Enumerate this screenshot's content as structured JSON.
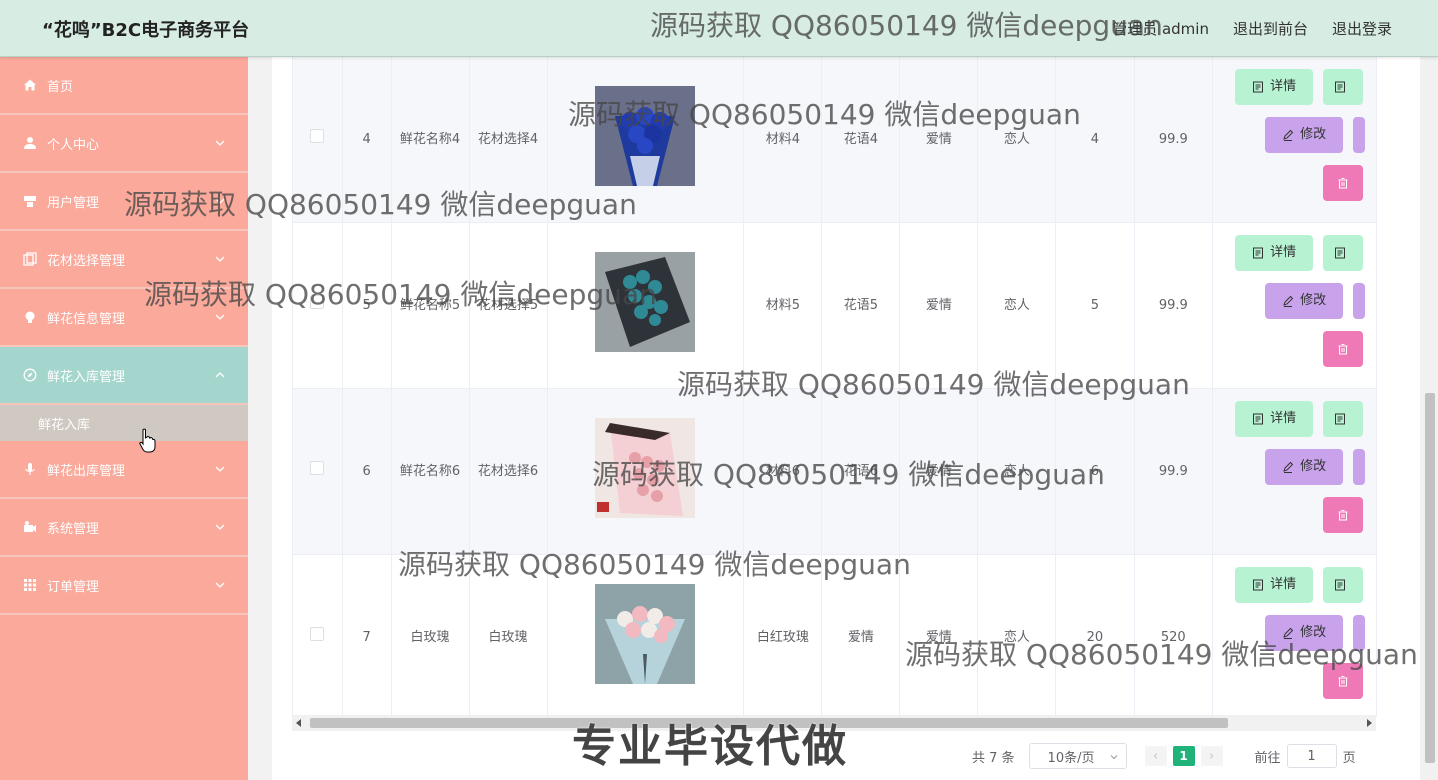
{
  "header": {
    "brand": "“花鸣”B2C电子商务平台",
    "user": "管理员 admin",
    "to_front": "退出到前台",
    "logout": "退出登录"
  },
  "sidebar": {
    "items": [
      {
        "label": "首页",
        "icon": "home-icon"
      },
      {
        "label": "个人中心",
        "icon": "user-icon"
      },
      {
        "label": "用户管理",
        "icon": "users-icon"
      },
      {
        "label": "花材选择管理",
        "icon": "copy-icon"
      },
      {
        "label": "鲜花信息管理",
        "icon": "bulb-icon"
      },
      {
        "label": "鲜花入库管理",
        "icon": "compass-icon"
      },
      {
        "label": "鲜花出库管理",
        "icon": "mic-icon"
      },
      {
        "label": "系统管理",
        "icon": "camera-icon"
      },
      {
        "label": "订单管理",
        "icon": "grid-icon"
      }
    ],
    "active_sub": "鲜花入库"
  },
  "table": {
    "rows": [
      {
        "id": "4",
        "name": "鲜花名称4",
        "material_choice": "花材选择4",
        "image": "blue-rose-bouquet",
        "material": "材料4",
        "flower_language": "花语4",
        "theme": "爱情",
        "recipient": "恋人",
        "qty": "4",
        "price": "99.9"
      },
      {
        "id": "5",
        "name": "鲜花名称5",
        "material_choice": "花材选择5",
        "image": "blue-rose-box",
        "material": "材料5",
        "flower_language": "花语5",
        "theme": "爱情",
        "recipient": "恋人",
        "qty": "5",
        "price": "99.9"
      },
      {
        "id": "6",
        "name": "鲜花名称6",
        "material_choice": "花材选择6",
        "image": "pink-rose-box",
        "material": "材料6",
        "flower_language": "花语6",
        "theme": "爱情",
        "recipient": "恋人",
        "qty": "6",
        "price": "99.9"
      },
      {
        "id": "7",
        "name": "白玫瑰",
        "material_choice": "白玫瑰",
        "image": "pink-white-bouquet",
        "material": "白红玫瑰",
        "flower_language": "爱情",
        "theme": "爱情",
        "recipient": "恋人",
        "qty": "20",
        "price": "520"
      }
    ],
    "buttons": {
      "detail": "详情",
      "edit": "修改"
    }
  },
  "pager": {
    "total": "共 7 条",
    "page_size": "10条/页",
    "current": "1",
    "goto_label": "前往",
    "goto_value": "1",
    "page_suffix": "页"
  },
  "watermarks": {
    "qq": "源码获取 QQ86050149 微信deepguan",
    "big": "专业毕设代做"
  },
  "colors": {
    "sidebar_bg": "#fba99b",
    "sidebar_active": "#a4d6ce",
    "header_bg": "#d7ece3",
    "btn_detail": "#b7f2d3",
    "btn_edit": "#c8a2ea",
    "btn_delete": "#ef79b6",
    "pager_active": "#1fb37a"
  }
}
